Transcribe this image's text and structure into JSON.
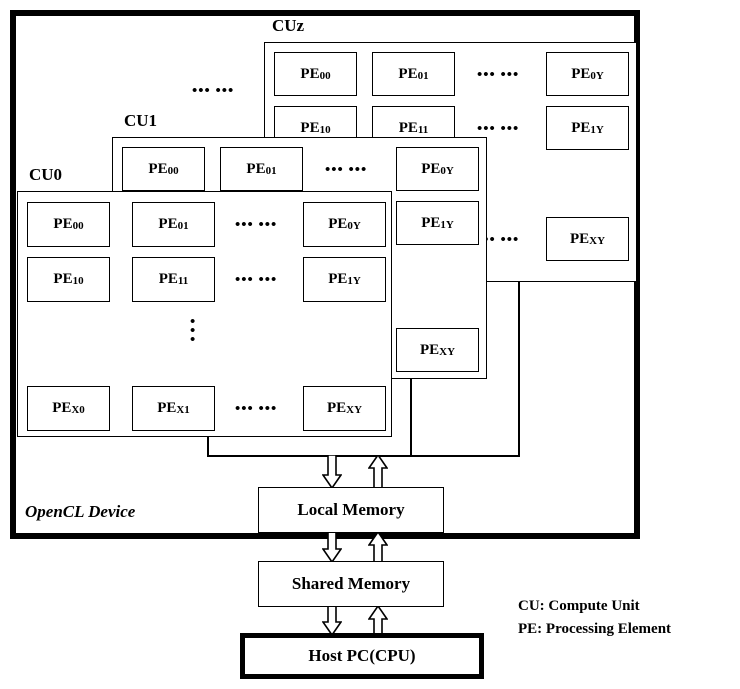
{
  "device": {
    "label": "OpenCL Device"
  },
  "compute_units": [
    {
      "id": "cu-z",
      "title": "CUz",
      "rows": [
        {
          "cells": [
            "PE00",
            "PE01"
          ],
          "ellipsis": "••• •••",
          "last": "PE0Y"
        },
        {
          "cells": [
            "PE10",
            "PE11"
          ],
          "ellipsis": "••• •••",
          "last": "PE1Y"
        },
        {
          "cells": [],
          "ellipsis": "••• •••",
          "last": "PEXY"
        }
      ]
    },
    {
      "id": "cu-1",
      "title": "CU1",
      "rows": [
        {
          "cells": [
            "PE00",
            "PE01"
          ],
          "ellipsis": "••• •••",
          "last": "PE0Y"
        },
        {
          "cells": [],
          "ellipsis": "",
          "last": "PE1Y"
        },
        {
          "cells": [],
          "ellipsis": "",
          "last": "PEXY"
        }
      ]
    },
    {
      "id": "cu-0",
      "title": "CU0",
      "rows": [
        {
          "cells": [
            "PE00",
            "PE01"
          ],
          "ellipsis": "••• •••",
          "last": "PE0Y"
        },
        {
          "cells": [
            "PE10",
            "PE11"
          ],
          "ellipsis": "••• •••",
          "last": "PE1Y"
        },
        {
          "cells": [
            "PEX0",
            "PEX1"
          ],
          "ellipsis": "••• •••",
          "last": "PEXY"
        }
      ]
    }
  ],
  "pe_labels": {
    "cu0": {
      "r0c0_base": "PE",
      "r0c0_sub": "00",
      "r0c1_base": "PE",
      "r0c1_sub": "01",
      "r0c3_base": "PE",
      "r0c3_sub": "0Y",
      "r1c0_base": "PE",
      "r1c0_sub": "10",
      "r1c1_base": "PE",
      "r1c1_sub": "11",
      "r1c3_base": "PE",
      "r1c3_sub": "1Y",
      "r2c0_base": "PE",
      "r2c0_sub": "X0",
      "r2c1_base": "PE",
      "r2c1_sub": "X1",
      "r2c3_base": "PE",
      "r2c3_sub": "XY"
    },
    "cu1": {
      "r0c0_base": "PE",
      "r0c0_sub": "00",
      "r0c1_base": "PE",
      "r0c1_sub": "01",
      "r0c3_base": "PE",
      "r0c3_sub": "0Y",
      "r1c3_base": "PE",
      "r1c3_sub": "1Y",
      "r2c3_base": "PE",
      "r2c3_sub": "XY"
    },
    "cuz": {
      "r0c0_base": "PE",
      "r0c0_sub": "00",
      "r0c1_base": "PE",
      "r0c1_sub": "01",
      "r0c3_base": "PE",
      "r0c3_sub": "0Y",
      "r1c0_base": "PE",
      "r1c0_sub": "10",
      "r1c1_base": "PE",
      "r1c1_sub": "11",
      "r1c3_base": "PE",
      "r1c3_sub": "1Y",
      "r2c3_base": "PE",
      "r2c3_sub": "XY"
    }
  },
  "ellipses": {
    "horizontal": "••• •••",
    "vertical": "•\n•\n•",
    "stack_top": "••• •••"
  },
  "memory": {
    "local": "Local Memory",
    "shared": "Shared Memory",
    "host": "Host PC(CPU)"
  },
  "legend": {
    "line1": "CU: Compute Unit",
    "line2": "PE: Processing Element"
  },
  "colors": {
    "stroke": "#000000",
    "background": "#ffffff"
  }
}
